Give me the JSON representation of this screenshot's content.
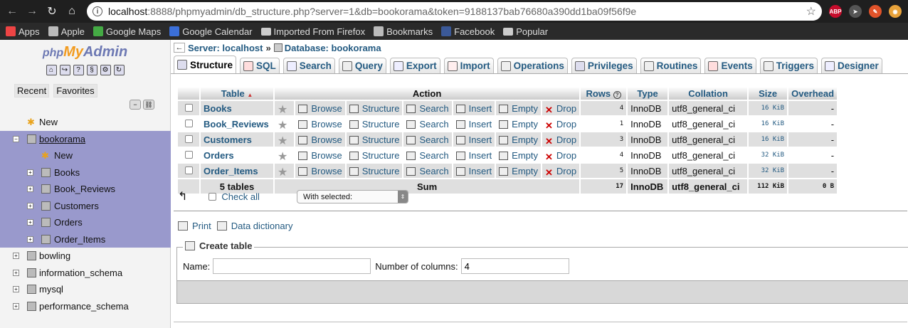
{
  "browser": {
    "url_host": "localhost",
    "url_rest": ":8888/phpmyadmin/db_structure.php?server=1&db=bookorama&token=9188137bab76680a390dd1ba09f56f9e",
    "extensions": [
      {
        "name": "abp-icon",
        "label": "ABP",
        "color": "#c70d2c"
      },
      {
        "name": "arrow-ext-icon",
        "label": "",
        "color": "#555555"
      },
      {
        "name": "pen-ext-icon",
        "label": "",
        "color": "#e0532a"
      },
      {
        "name": "compass-ext-icon",
        "label": "",
        "color": "#e8a23a"
      }
    ]
  },
  "bookmarks": [
    {
      "label": "Apps",
      "icon": "apps-grid-icon"
    },
    {
      "label": "Apple",
      "icon": "apple-icon"
    },
    {
      "label": "Google Maps",
      "icon": "maps-icon"
    },
    {
      "label": "Google Calendar",
      "icon": "calendar-icon"
    },
    {
      "label": "Imported From Firefox",
      "icon": "folder-icon"
    },
    {
      "label": "Bookmarks",
      "icon": "star-icon"
    },
    {
      "label": "Facebook",
      "icon": "facebook-icon"
    },
    {
      "label": "Popular",
      "icon": "folder-icon"
    }
  ],
  "sidebar": {
    "logo": {
      "php": "php",
      "my": "My",
      "admin": "Admin"
    },
    "recent_label": "Recent",
    "favorites_label": "Favorites",
    "tree": {
      "new_label": "New",
      "active_db": "bookorama",
      "active_children": [
        "New",
        "Books",
        "Book_Reviews",
        "Customers",
        "Orders",
        "Order_Items"
      ],
      "other_dbs": [
        "bowling",
        "information_schema",
        "mysql",
        "performance_schema"
      ]
    }
  },
  "breadcrumb": {
    "server": "Server: localhost",
    "separator": "»",
    "database": "Database: bookorama"
  },
  "tabs": [
    "Structure",
    "SQL",
    "Search",
    "Query",
    "Export",
    "Import",
    "Operations",
    "Privileges",
    "Routines",
    "Events",
    "Triggers",
    "Designer"
  ],
  "table": {
    "headers": {
      "table": "Table",
      "sort_indicator": "▲",
      "action": "Action",
      "rows": "Rows",
      "rows_help": "?",
      "type": "Type",
      "collation": "Collation",
      "size": "Size",
      "overhead": "Overhead"
    },
    "action_labels": {
      "browse": "Browse",
      "structure": "Structure",
      "search": "Search",
      "insert": "Insert",
      "empty": "Empty",
      "drop": "Drop"
    },
    "rows": [
      {
        "name": "Books",
        "rows": "4",
        "type": "InnoDB",
        "collation": "utf8_general_ci",
        "size": "16 KiB",
        "overhead": "-"
      },
      {
        "name": "Book_Reviews",
        "rows": "1",
        "type": "InnoDB",
        "collation": "utf8_general_ci",
        "size": "16 KiB",
        "overhead": "-"
      },
      {
        "name": "Customers",
        "rows": "3",
        "type": "InnoDB",
        "collation": "utf8_general_ci",
        "size": "16 KiB",
        "overhead": "-"
      },
      {
        "name": "Orders",
        "rows": "4",
        "type": "InnoDB",
        "collation": "utf8_general_ci",
        "size": "32 KiB",
        "overhead": "-"
      },
      {
        "name": "Order_Items",
        "rows": "5",
        "type": "InnoDB",
        "collation": "utf8_general_ci",
        "size": "32 KiB",
        "overhead": "-"
      }
    ],
    "summary": {
      "tables": "5 tables",
      "sum": "Sum",
      "rows": "17",
      "type": "InnoDB",
      "collation": "utf8_general_ci",
      "size": "112 KiB",
      "overhead": "0 B"
    }
  },
  "check_all_label": "Check all",
  "with_selected": "With selected:",
  "print_label": "Print",
  "data_dictionary_label": "Data dictionary",
  "create_table": {
    "legend": "Create table",
    "name_label": "Name:",
    "name_value": "",
    "columns_label": "Number of columns:",
    "columns_value": "4"
  }
}
